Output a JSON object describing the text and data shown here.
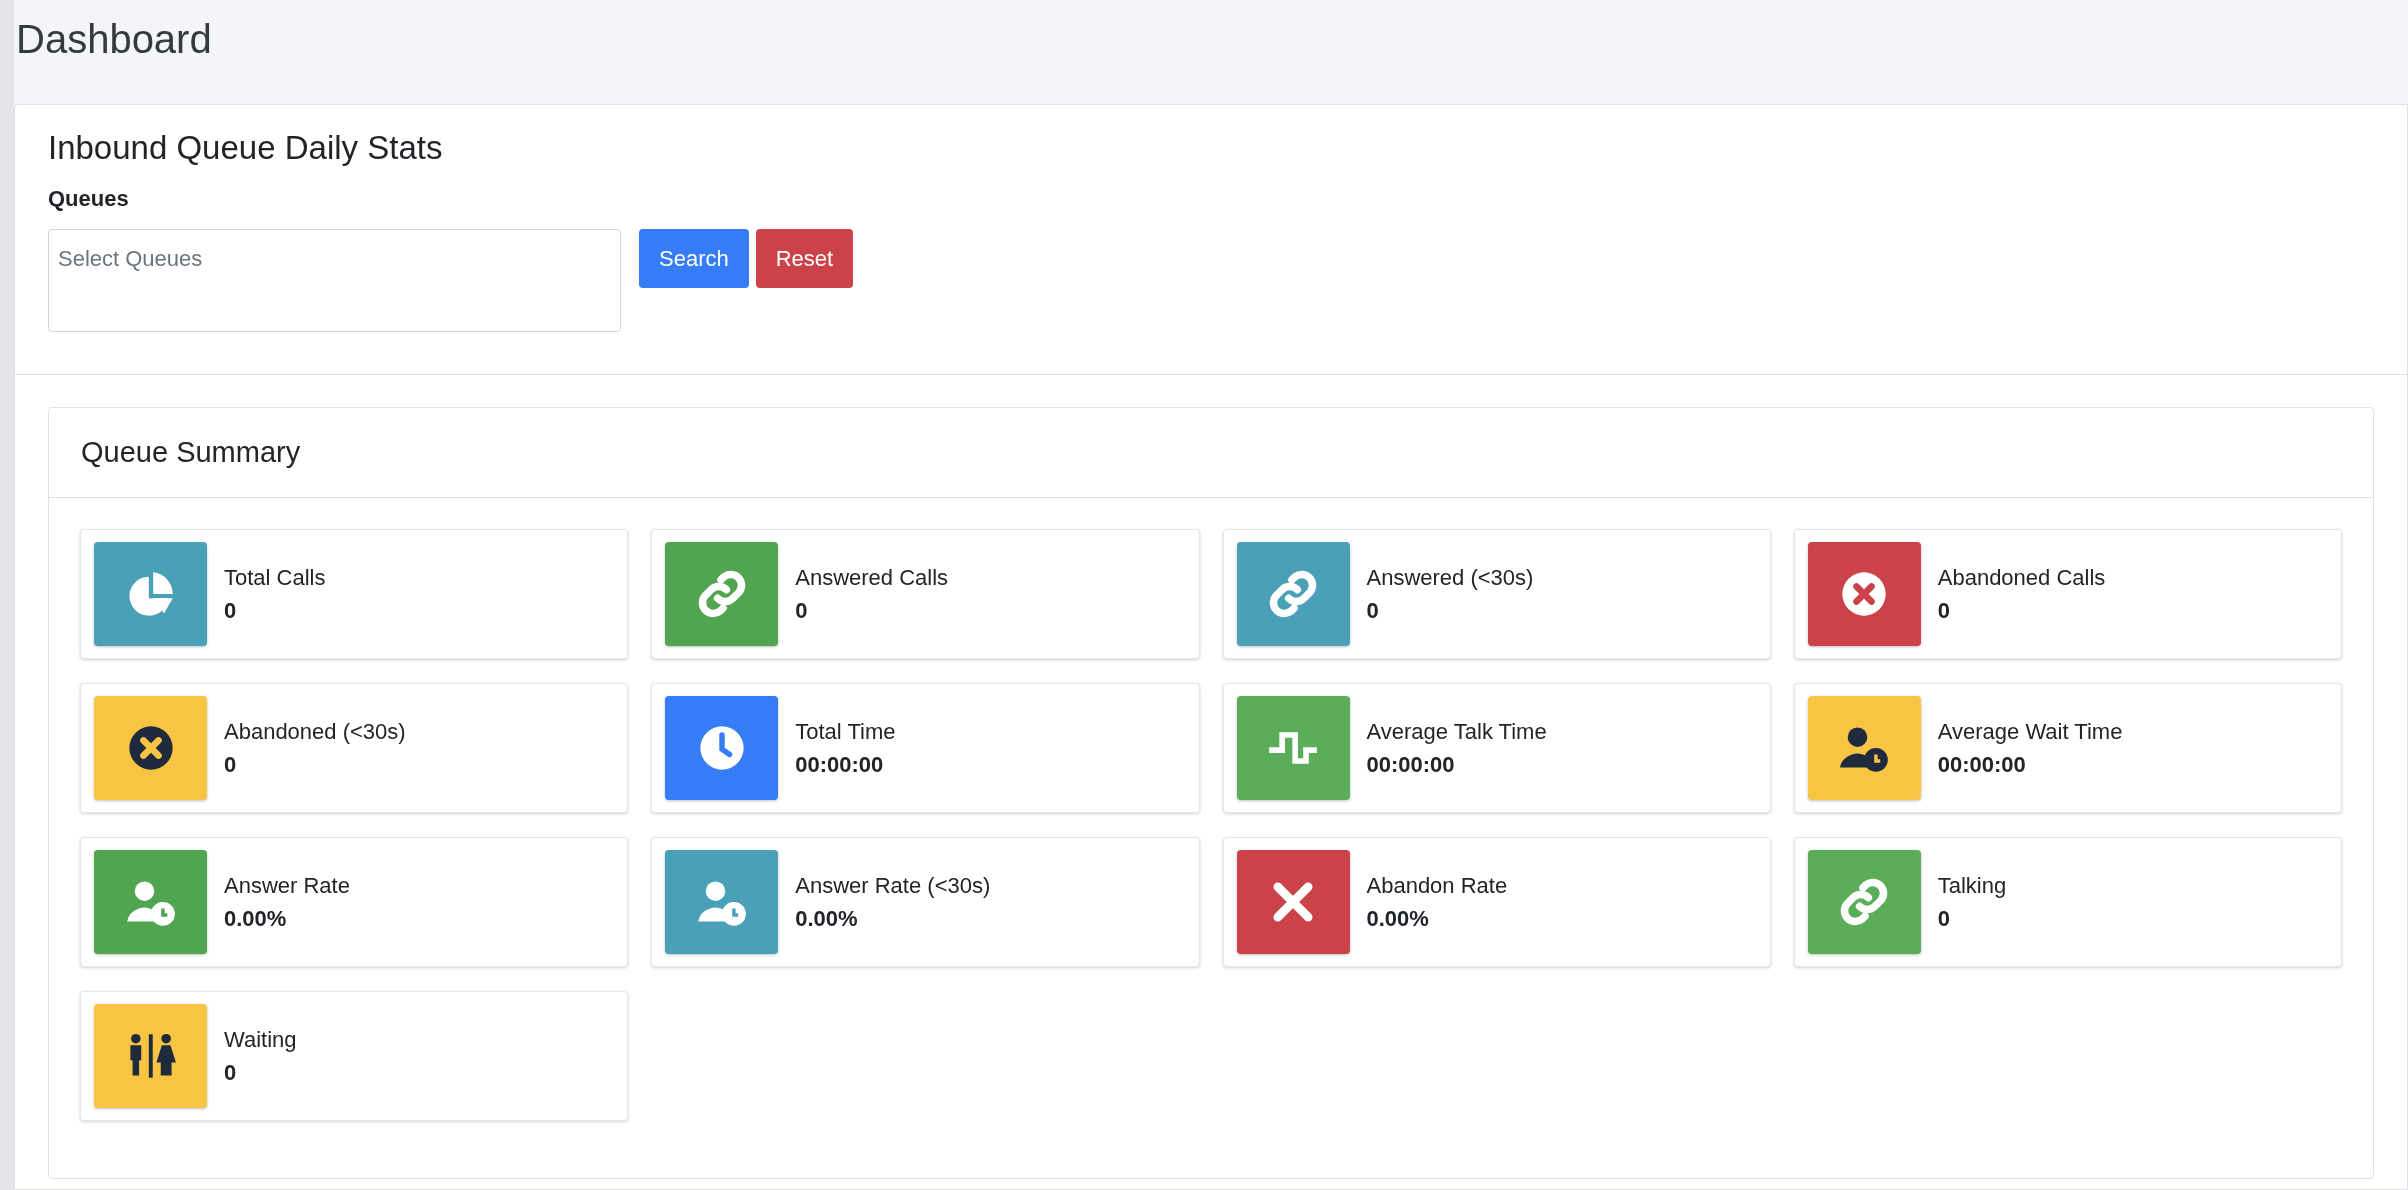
{
  "page_title": "Dashboard",
  "filter_card": {
    "title": "Inbound Queue Daily Stats",
    "queues_label": "Queues",
    "queues_field": {
      "placeholder": "Select Queues"
    },
    "buttons": [
      {
        "kind": "primary",
        "label": "Search"
      },
      {
        "kind": "danger",
        "label": "Reset"
      }
    ]
  },
  "summary": {
    "title": "Queue Summary",
    "stats": [
      {
        "kind": "pie",
        "color": "#4aa1b7",
        "label": "Total Calls",
        "value": "0"
      },
      {
        "kind": "link",
        "color": "#52a550",
        "label": "Answered Calls",
        "value": "0"
      },
      {
        "kind": "link",
        "color": "#4aa1b7",
        "label": "Answered (<30s)",
        "value": "0"
      },
      {
        "kind": "x-circle",
        "color": "#cc4249",
        "label": "Abandoned Calls",
        "value": "0"
      },
      {
        "kind": "x-circle",
        "color": "#f7c444",
        "label": "Abandoned (<30s)",
        "value": "0"
      },
      {
        "kind": "clock",
        "color": "#367cf6",
        "label": "Total Time",
        "value": "00:00:00"
      },
      {
        "kind": "pulse",
        "color": "#5cad5a",
        "label": "Average Talk Time",
        "value": "00:00:00"
      },
      {
        "kind": "user-clock",
        "color": "#f7c444",
        "label": "Average Wait Time",
        "value": "00:00:00"
      },
      {
        "kind": "user-clock",
        "color": "#52a550",
        "label": "Answer Rate",
        "value": "0.00%"
      },
      {
        "kind": "user-clock",
        "color": "#4aa1b7",
        "label": "Answer Rate (<30s)",
        "value": "0.00%"
      },
      {
        "kind": "x",
        "color": "#cc4249",
        "label": "Abandon Rate",
        "value": "0.00%"
      },
      {
        "kind": "link",
        "color": "#5cad5a",
        "label": "Talking",
        "value": "0"
      },
      {
        "kind": "people",
        "color": "#f7c444",
        "label": "Waiting",
        "value": "0"
      }
    ]
  }
}
